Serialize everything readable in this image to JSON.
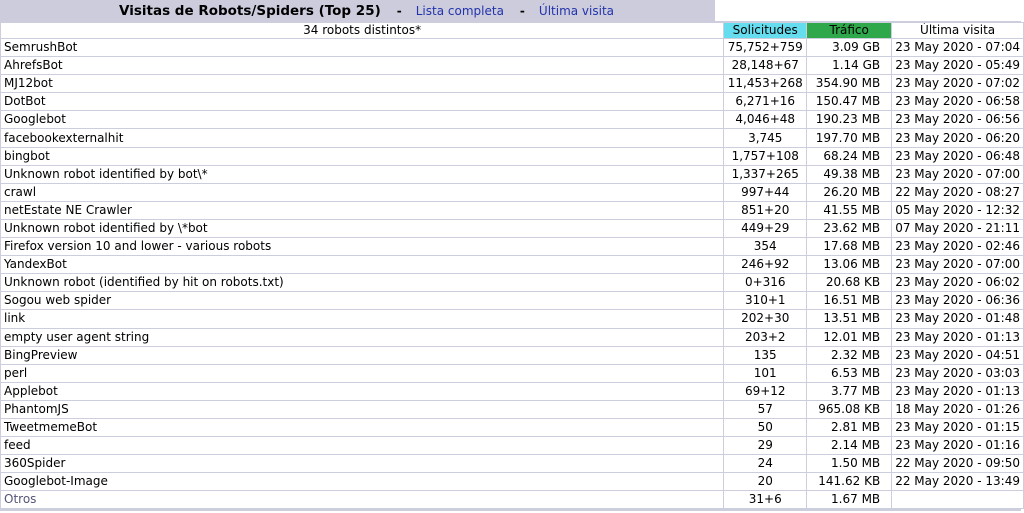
{
  "header": {
    "title": "Visitas de Robots/Spiders (Top 25)",
    "sep1": "-",
    "full_list": "Lista completa",
    "sep2": "-",
    "last_visit": "Última visita"
  },
  "table": {
    "count_label": "34 robots distintos*",
    "col_requests": "Solicitudes",
    "col_traffic": "Tráfico",
    "col_last": "Última visita",
    "colors": {
      "requests_header": "#66ddee",
      "traffic_header": "#2ea84a",
      "title_bar": "#ccccdd"
    },
    "rows": [
      {
        "name": "SemrushBot",
        "hits": "75,752+759",
        "bw": "3.09 GB",
        "last": "23 May 2020 - 07:04"
      },
      {
        "name": "AhrefsBot",
        "hits": "28,148+67",
        "bw": "1.14 GB",
        "last": "23 May 2020 - 05:49"
      },
      {
        "name": "MJ12bot",
        "hits": "11,453+268",
        "bw": "354.90 MB",
        "last": "23 May 2020 - 07:02"
      },
      {
        "name": "DotBot",
        "hits": "6,271+16",
        "bw": "150.47 MB",
        "last": "23 May 2020 - 06:58"
      },
      {
        "name": "Googlebot",
        "hits": "4,046+48",
        "bw": "190.23 MB",
        "last": "23 May 2020 - 06:56"
      },
      {
        "name": "facebookexternalhit",
        "hits": "3,745",
        "bw": "197.70 MB",
        "last": "23 May 2020 - 06:20"
      },
      {
        "name": "bingbot",
        "hits": "1,757+108",
        "bw": "68.24 MB",
        "last": "23 May 2020 - 06:48"
      },
      {
        "name": "Unknown robot identified by bot\\*",
        "hits": "1,337+265",
        "bw": "49.38 MB",
        "last": "23 May 2020 - 07:00"
      },
      {
        "name": "crawl",
        "hits": "997+44",
        "bw": "26.20 MB",
        "last": "22 May 2020 - 08:27"
      },
      {
        "name": "netEstate NE Crawler",
        "hits": "851+20",
        "bw": "41.55 MB",
        "last": "05 May 2020 - 12:32"
      },
      {
        "name": "Unknown robot identified by \\*bot",
        "hits": "449+29",
        "bw": "23.62 MB",
        "last": "07 May 2020 - 21:11"
      },
      {
        "name": "Firefox version 10 and lower - various robots",
        "hits": "354",
        "bw": "17.68 MB",
        "last": "23 May 2020 - 02:46"
      },
      {
        "name": "YandexBot",
        "hits": "246+92",
        "bw": "13.06 MB",
        "last": "23 May 2020 - 07:00"
      },
      {
        "name": "Unknown robot (identified by hit on robots.txt)",
        "hits": "0+316",
        "bw": "20.68 KB",
        "last": "23 May 2020 - 06:02"
      },
      {
        "name": "Sogou web spider",
        "hits": "310+1",
        "bw": "16.51 MB",
        "last": "23 May 2020 - 06:36"
      },
      {
        "name": "link",
        "hits": "202+30",
        "bw": "13.51 MB",
        "last": "23 May 2020 - 01:48"
      },
      {
        "name": "empty user agent string",
        "hits": "203+2",
        "bw": "12.01 MB",
        "last": "23 May 2020 - 01:13"
      },
      {
        "name": "BingPreview",
        "hits": "135",
        "bw": "2.32 MB",
        "last": "23 May 2020 - 04:51"
      },
      {
        "name": "perl",
        "hits": "101",
        "bw": "6.53 MB",
        "last": "23 May 2020 - 03:03"
      },
      {
        "name": "Applebot",
        "hits": "69+12",
        "bw": "3.77 MB",
        "last": "23 May 2020 - 01:13"
      },
      {
        "name": "PhantomJS",
        "hits": "57",
        "bw": "965.08 KB",
        "last": "18 May 2020 - 01:26"
      },
      {
        "name": "TweetmemeBot",
        "hits": "50",
        "bw": "2.81 MB",
        "last": "23 May 2020 - 01:15"
      },
      {
        "name": "feed",
        "hits": "29",
        "bw": "2.14 MB",
        "last": "23 May 2020 - 01:16"
      },
      {
        "name": "360Spider",
        "hits": "24",
        "bw": "1.50 MB",
        "last": "22 May 2020 - 09:50"
      },
      {
        "name": "Googlebot-Image",
        "hits": "20",
        "bw": "141.62 KB",
        "last": "22 May 2020 - 13:49"
      }
    ],
    "other": {
      "name": "Otros",
      "hits": "31+6",
      "bw": "1.67 MB",
      "last": ""
    }
  }
}
